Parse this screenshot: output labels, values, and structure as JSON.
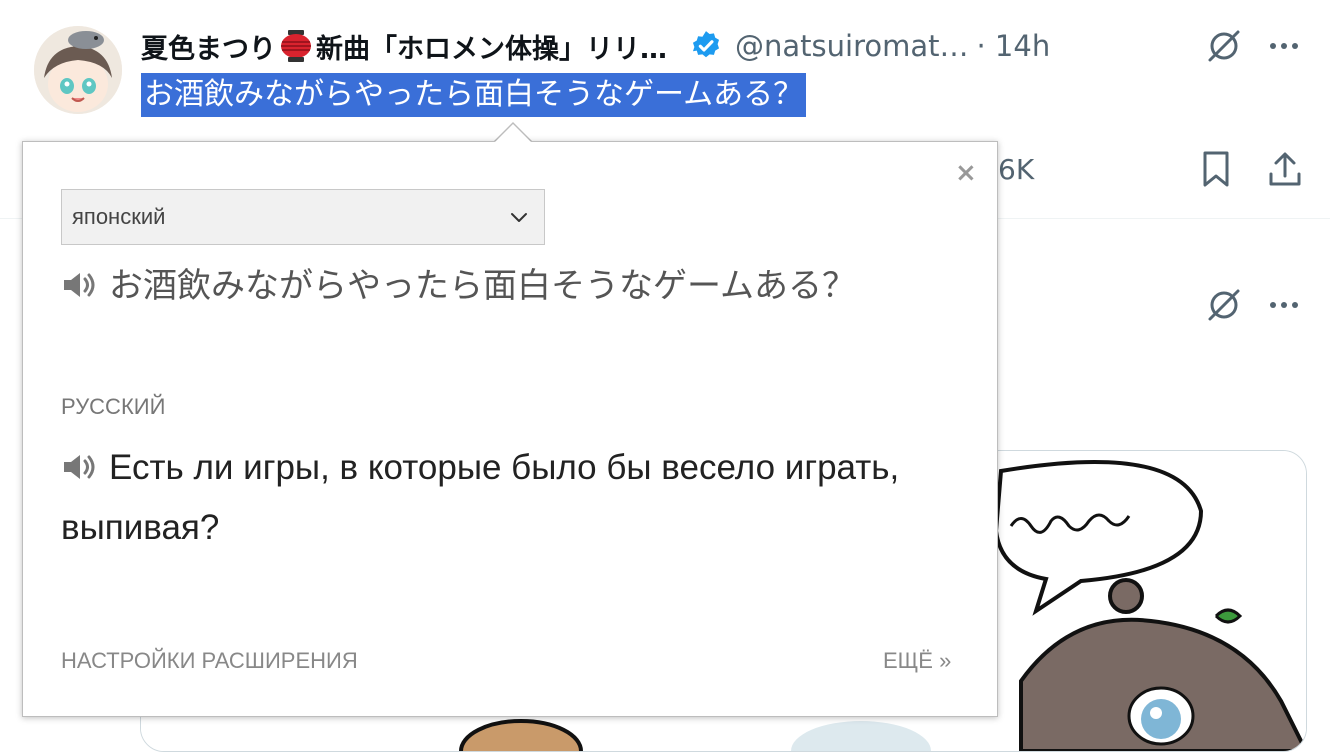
{
  "tweet": {
    "author_name_part1": "夏色まつり",
    "author_name_part2": "新曲「ホロメン体操」リリ…",
    "handle": "@natsuiromat…",
    "time": "· 14h",
    "text": "お酒飲みながらやったら面白そうなゲームある？",
    "action_count": "6K"
  },
  "translator": {
    "source_language": "японский",
    "source_text": "お酒飲みながらやったら面白そうなゲームある？",
    "target_language": "РУССКИЙ",
    "target_text": "Есть ли игры, в которые было бы весело играть, выпивая?",
    "settings_link": "НАСТРОЙКИ РАСШИРЕНИЯ",
    "more_link": "ЕЩЁ »",
    "close_symbol": "×"
  },
  "colors": {
    "selection_bg": "#3a6fd8",
    "verified": "#1d9bf0",
    "muted": "#536471",
    "lantern": "#d9232e"
  },
  "icons": [
    "grok-icon",
    "more-icon",
    "verified-badge-icon",
    "bookmark-icon",
    "share-icon",
    "speaker-icon",
    "chevron-down-icon",
    "close-icon",
    "lantern-emoji-icon"
  ]
}
